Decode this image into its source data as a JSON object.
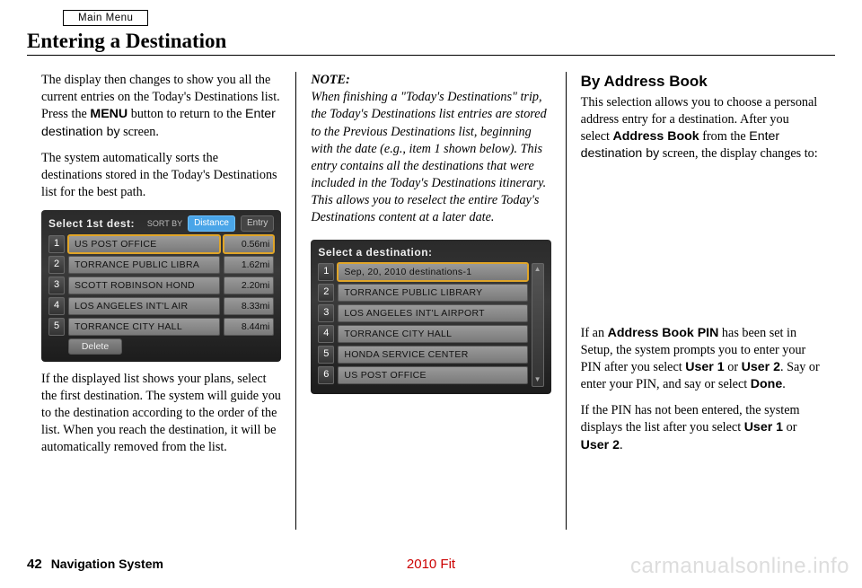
{
  "header": {
    "main_menu": "Main Menu",
    "title": "Entering a Destination"
  },
  "col1": {
    "p1a": "The display then changes to show you all the current entries on the Today's Destinations list. Press the ",
    "p1_menu": "MENU",
    "p1b": " button to return to the ",
    "p1_enter": "Enter destination by",
    "p1c": " screen.",
    "p2": "The system automatically sorts the destinations stored in the Today's Destinations list for the best path.",
    "screen": {
      "head_label": "Select 1st dest:",
      "sort_by": "SORT BY",
      "distance": "Distance",
      "entry": "Entry",
      "rows": [
        {
          "n": "1",
          "name": "US POST OFFICE",
          "dist": "0.56mi",
          "hl": true
        },
        {
          "n": "2",
          "name": "TORRANCE PUBLIC LIBRA",
          "dist": "1.62mi"
        },
        {
          "n": "3",
          "name": "SCOTT ROBINSON HOND",
          "dist": "2.20mi"
        },
        {
          "n": "4",
          "name": "LOS ANGELES INT'L AIR",
          "dist": "8.33mi"
        },
        {
          "n": "5",
          "name": "TORRANCE CITY HALL",
          "dist": "8.44mi"
        }
      ],
      "delete": "Delete"
    },
    "p3": "If the displayed list shows your plans, select the first destination. The system will guide you to the destination according to the order of the list. When you reach the destination, it will be automatically removed from the list."
  },
  "col2": {
    "note_label": "NOTE:",
    "note_body": "When finishing a \"Today's Destinations\" trip, the Today's Destinations list entries are stored to the Previous Destinations list, beginning with the date (e.g., item 1 shown below). This entry contains all the destinations that were included in the Today's Destinations itinerary. This allows you to reselect the entire Today's Destinations content at a later date.",
    "screen": {
      "head_label": "Select a destination:",
      "rows": [
        {
          "n": "1",
          "name": "Sep, 20, 2010 destinations-1",
          "hl": true
        },
        {
          "n": "2",
          "name": "TORRANCE PUBLIC LIBRARY"
        },
        {
          "n": "3",
          "name": "LOS ANGELES INT'L AIRPORT"
        },
        {
          "n": "4",
          "name": "TORRANCE CITY HALL"
        },
        {
          "n": "5",
          "name": "HONDA SERVICE CENTER"
        },
        {
          "n": "6",
          "name": "US POST OFFICE"
        }
      ]
    }
  },
  "col3": {
    "h": "By Address Book",
    "p1a": "This selection allows you to choose a personal address entry for a destination. After you select ",
    "p1_ab": "Address Book",
    "p1b": " from the ",
    "p1_enter": "Enter destination by",
    "p1c": " screen, the display changes to:",
    "p2a": "If an ",
    "p2_pin": "Address Book PIN",
    "p2b": " has been set in Setup, the system prompts you to enter your PIN after you select ",
    "p2_u1": "User 1",
    "p2c": " or ",
    "p2_u2": "User 2",
    "p2d": ". Say or enter your PIN, and say or select ",
    "p2_done": "Done",
    "p2e": ".",
    "p3a": "If the PIN has not been entered, the system displays the list after you select ",
    "p3_u1": "User 1",
    "p3b": " or ",
    "p3_u2": "User 2",
    "p3c": "."
  },
  "footer": {
    "page": "42",
    "section": "Navigation System",
    "model": "2010 Fit",
    "watermark": "carmanualsonline.info"
  }
}
